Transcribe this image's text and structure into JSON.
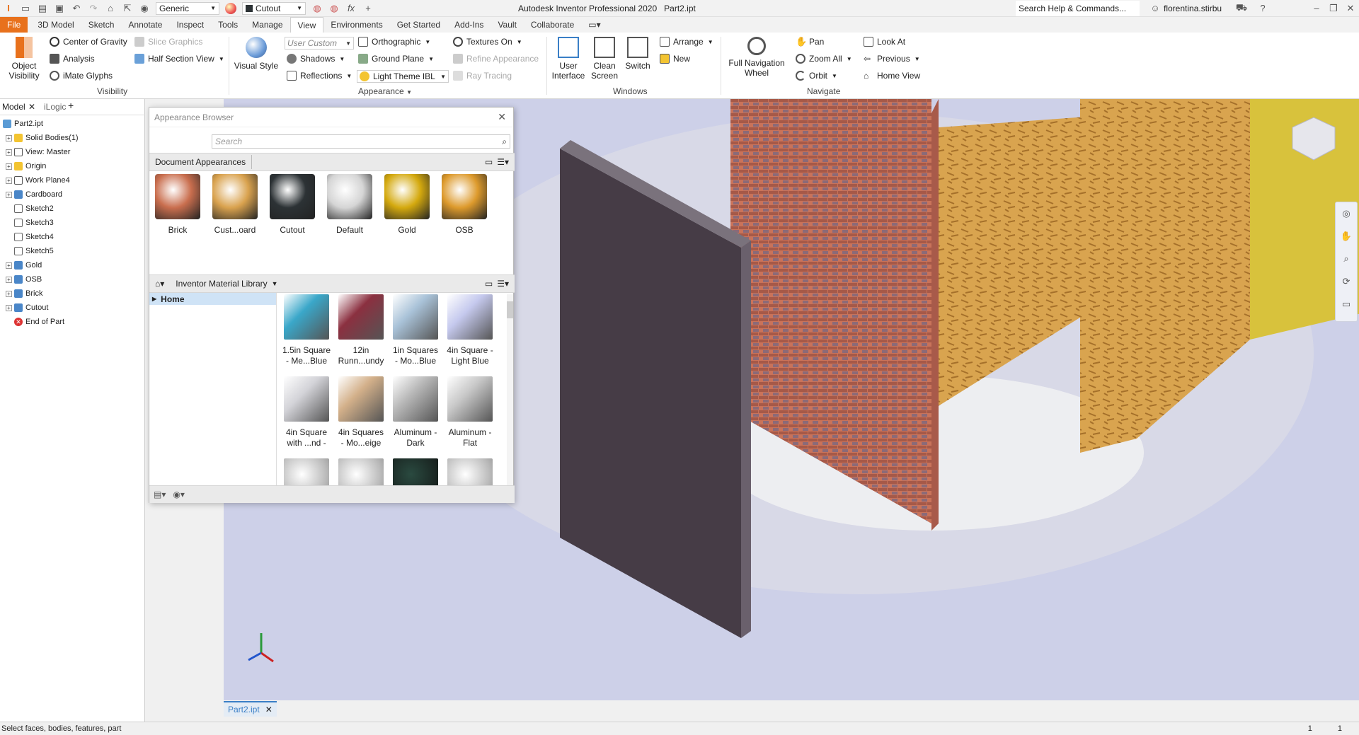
{
  "qat": {
    "style_combo": "Generic",
    "appearance_combo": "Cutout",
    "title": "Autodesk Inventor Professional 2020",
    "doc": "Part2.ipt",
    "search": "Search Help & Commands...",
    "user": "florentina.stirbu"
  },
  "tabs": [
    "File",
    "3D Model",
    "Sketch",
    "Annotate",
    "Inspect",
    "Tools",
    "Manage",
    "View",
    "Environments",
    "Get Started",
    "Add-Ins",
    "Vault",
    "Collaborate"
  ],
  "ribbon": {
    "object_visibility": "Object\nVisibility",
    "cog": "Center of Gravity",
    "analysis": "Analysis",
    "imate": "iMate Glyphs",
    "slice": "Slice Graphics",
    "half_section": "Half Section View",
    "visibility_group": "Visibility",
    "visual_style": "Visual Style",
    "user_custom": "User Custom",
    "shadows": "Shadows",
    "reflections": "Reflections",
    "orthographic": "Orthographic",
    "ground_plane": "Ground Plane",
    "light_theme": "Light Theme IBL",
    "textures": "Textures On",
    "refine": "Refine Appearance",
    "ray_tracing": "Ray Tracing",
    "appearance_group": "Appearance",
    "user_interface": "User\nInterface",
    "clean_screen": "Clean\nScreen",
    "switch": "Switch",
    "arrange": "Arrange",
    "new": "New",
    "windows_group": "Windows",
    "full_nav": "Full Navigation\nWheel",
    "pan": "Pan",
    "zoom_all": "Zoom All",
    "orbit": "Orbit",
    "look_at": "Look At",
    "previous": "Previous",
    "home_view": "Home View",
    "navigate_group": "Navigate"
  },
  "browser": {
    "tab_model": "Model",
    "tab_ilogic": "iLogic",
    "nodes": [
      "Part2.ipt",
      "Solid Bodies(1)",
      "View: Master",
      "Origin",
      "Work Plane4",
      "Cardboard",
      "Sketch2",
      "Sketch3",
      "Sketch4",
      "Sketch5",
      "Gold",
      "OSB",
      "Brick",
      "Cutout",
      "End of Part"
    ]
  },
  "dialog": {
    "title": "Appearance Browser",
    "search_placeholder": "Search",
    "doc_section": "Document Appearances",
    "doc_items": [
      {
        "label": "Brick",
        "color": "#c96e4e"
      },
      {
        "label": "Cust...oard",
        "color": "#d9a24e"
      },
      {
        "label": "Cutout",
        "color": "#2c3235"
      },
      {
        "label": "Default",
        "color": "#d5d5d5"
      },
      {
        "label": "Gold",
        "color": "#d4a90e"
      },
      {
        "label": "OSB",
        "color": "#dd9a2c"
      }
    ],
    "library": "Inventor Material Library",
    "home": "Home",
    "lib_items": [
      {
        "l1": "1.5in Square",
        "l2": "- Me...Blue",
        "color": "#3aa7c9"
      },
      {
        "l1": "12in",
        "l2": "Runn...undy",
        "color": "#8b3040"
      },
      {
        "l1": "1in Squares",
        "l2": "- Mo...Blue",
        "color": "#a9c2d8"
      },
      {
        "l1": "4in Square -",
        "l2": "Light Blue",
        "color": "#c5c9ee"
      },
      {
        "l1": "4in Square",
        "l2": "with ...nd -",
        "color": "#d3d3d8"
      },
      {
        "l1": "4in Squares",
        "l2": "- Mo...eige",
        "color": "#d3b08a"
      },
      {
        "l1": "Aluminum -",
        "l2": "Dark",
        "color": "#b8b8b8"
      },
      {
        "l1": "Aluminum -",
        "l2": "Flat",
        "color": "#c8c8c8"
      }
    ]
  },
  "doc_tab": "Part2.ipt",
  "status": {
    "text": "Select faces, bodies, features, part",
    "n1": "1",
    "n2": "1"
  },
  "colors": {
    "file_tab": "#e8711c",
    "selection": "#cfe3f6"
  }
}
